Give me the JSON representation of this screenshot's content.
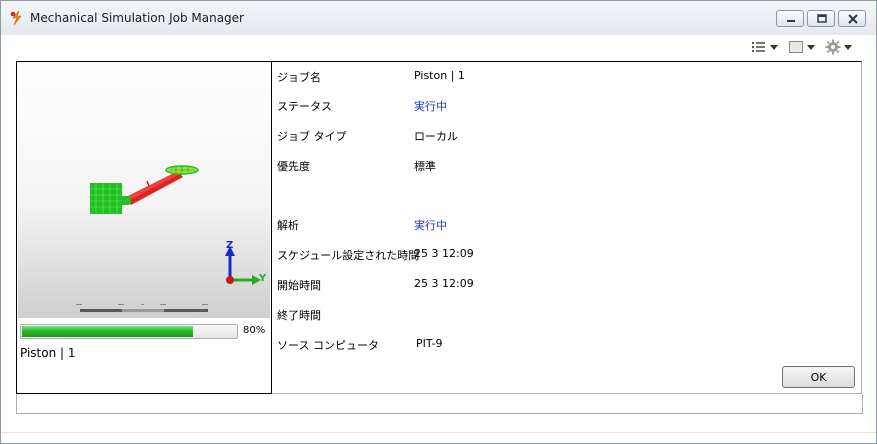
{
  "window": {
    "title": "Mechanical Simulation Job Manager"
  },
  "icons": {
    "app": "solidworks-simulation-icon",
    "minimize": "minimize-icon",
    "restore": "restore-icon",
    "close": "close-icon",
    "list": "list-view-icon",
    "panel": "panel-icon",
    "settings": "gear-icon"
  },
  "preview": {
    "axis_z": "Z",
    "axis_y": "Y",
    "progress_value": 80,
    "progress_label": "80%",
    "job_caption": "Piston | 1"
  },
  "details": {
    "rows": [
      {
        "label": "ジョブ名",
        "value": "Piston | 1"
      },
      {
        "label": "ステータス",
        "value": "実行中"
      },
      {
        "label": "ジョブ タイプ",
        "value": "ローカル"
      },
      {
        "label": "優先度",
        "value": "標準"
      },
      {
        "label": "解析",
        "value": "実行中"
      },
      {
        "label": "スケジュール設定された時間",
        "value": "25 3 12:09"
      },
      {
        "label": "開始時間",
        "value": "25 3 12:09"
      },
      {
        "label": "終了時間",
        "value": ""
      },
      {
        "label": "ソース コンピュータ",
        "value": "PIT-9"
      }
    ]
  },
  "buttons": {
    "ok": "OK"
  },
  "colors": {
    "running_status": "#1e36c8",
    "progress": "#27b327",
    "model_green": "#22c122",
    "model_red": "#e02424"
  }
}
